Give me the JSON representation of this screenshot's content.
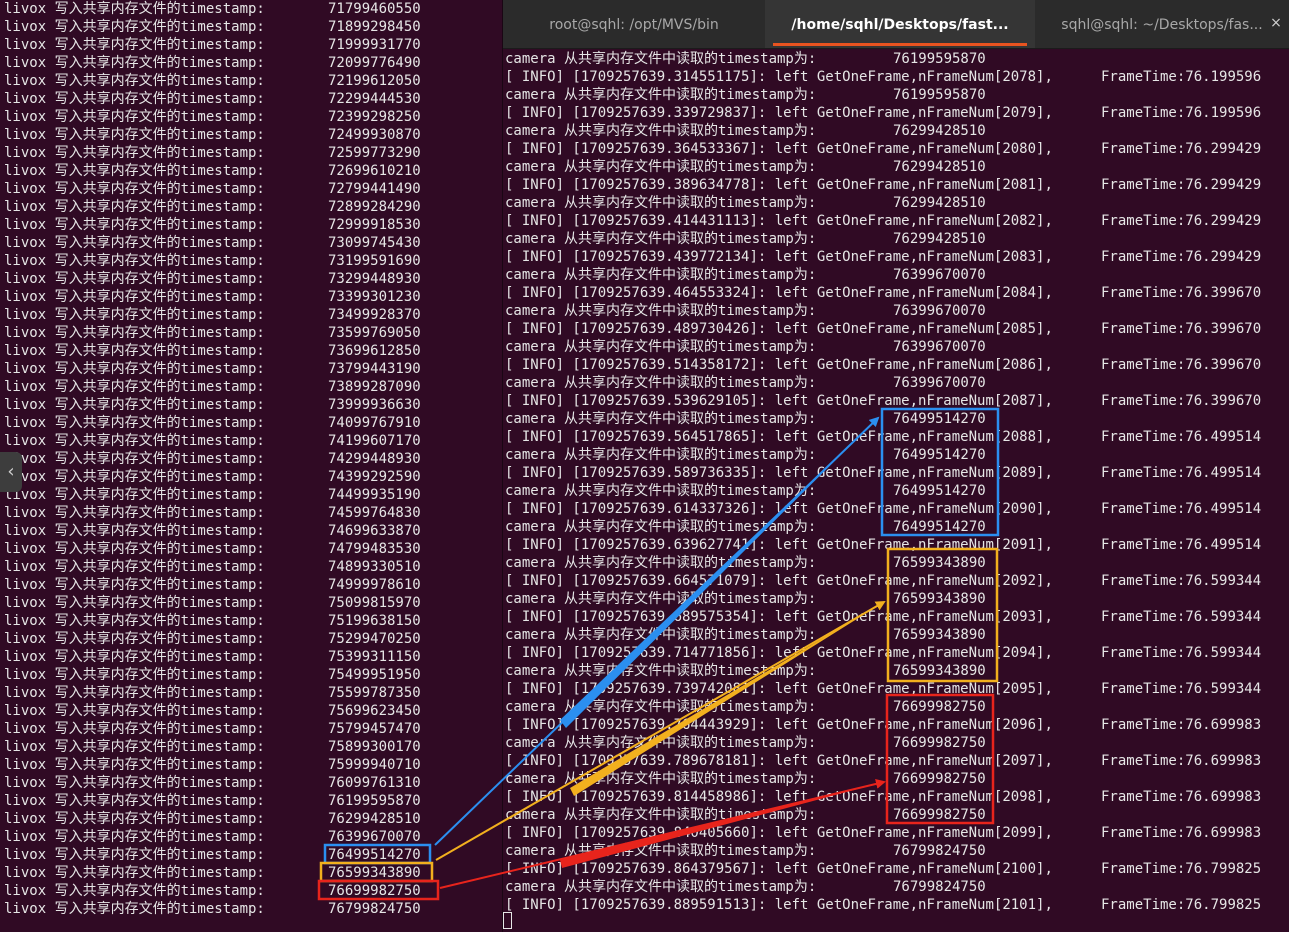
{
  "left_terminal": {
    "prefix": "livox 写入共享内存文件的timestamp:",
    "timestamps": [
      "71799460550",
      "71899298450",
      "71999931770",
      "72099776490",
      "72199612050",
      "72299444530",
      "72399298250",
      "72499930870",
      "72599773290",
      "72699610210",
      "72799441490",
      "72899284290",
      "72999918530",
      "73099745430",
      "73199591690",
      "73299448930",
      "73399301230",
      "73499928370",
      "73599769050",
      "73699612850",
      "73799443190",
      "73899287090",
      "73999936630",
      "74099767910",
      "74199607170",
      "74299448930",
      "74399292590",
      "74499935190",
      "74599764830",
      "74699633870",
      "74799483530",
      "74899330510",
      "74999978610",
      "75099815970",
      "75199638150",
      "75299470250",
      "75399311150",
      "75499951950",
      "75599787350",
      "75699623450",
      "75799457470",
      "75899300170",
      "75999940710",
      "76099761310",
      "76199595870",
      "76299428510",
      "76399670070",
      "76499514270",
      "76599343890",
      "76699982750",
      "76799824750"
    ],
    "handle_glyph": "‹"
  },
  "tabs": [
    {
      "label": "root@sqhl: /opt/MVS/bin",
      "active": false
    },
    {
      "label": "/home/sqhl/Desktops/fast...",
      "active": true
    },
    {
      "label": "sqhl@sqhl: ~/Desktops/fas...",
      "active": false
    }
  ],
  "tab_close_glyph": "×",
  "right_terminal": {
    "camera_prefix": "camera 从共享内存文件中读取的timestamp为:",
    "info_lines": [
      {
        "time": "1709257639.314551175",
        "frame": "2078",
        "ft": "76.199596"
      },
      {
        "time": "1709257639.339729837",
        "frame": "2079",
        "ft": "76.199596"
      },
      {
        "time": "1709257639.364533367",
        "frame": "2080",
        "ft": "76.299429"
      },
      {
        "time": "1709257639.389634778",
        "frame": "2081",
        "ft": "76.299429"
      },
      {
        "time": "1709257639.414431113",
        "frame": "2082",
        "ft": "76.299429"
      },
      {
        "time": "1709257639.439772134",
        "frame": "2083",
        "ft": "76.299429"
      },
      {
        "time": "1709257639.464553324",
        "frame": "2084",
        "ft": "76.399670"
      },
      {
        "time": "1709257639.489730426",
        "frame": "2085",
        "ft": "76.399670"
      },
      {
        "time": "1709257639.514358172",
        "frame": "2086",
        "ft": "76.399670"
      },
      {
        "time": "1709257639.539629105",
        "frame": "2087",
        "ft": "76.399670"
      },
      {
        "time": "1709257639.564517865",
        "frame": "2088",
        "ft": "76.499514"
      },
      {
        "time": "1709257639.589736335",
        "frame": "2089",
        "ft": "76.499514"
      },
      {
        "time": "1709257639.614337326",
        "frame": "2090",
        "ft": "76.499514"
      },
      {
        "time": "1709257639.639627741",
        "frame": "2091",
        "ft": "76.499514"
      },
      {
        "time": "1709257639.664571079",
        "frame": "2092",
        "ft": "76.599344"
      },
      {
        "time": "1709257639.689575354",
        "frame": "2093",
        "ft": "76.599344"
      },
      {
        "time": "1709257639.714771856",
        "frame": "2094",
        "ft": "76.599344"
      },
      {
        "time": "1709257639.739742081",
        "frame": "2095",
        "ft": "76.599344"
      },
      {
        "time": "1709257639.764443929",
        "frame": "2096",
        "ft": "76.699983"
      },
      {
        "time": "1709257639.789678181",
        "frame": "2097",
        "ft": "76.699983"
      },
      {
        "time": "1709257639.814458986",
        "frame": "2098",
        "ft": "76.699983"
      },
      {
        "time": "1709257639.840405660",
        "frame": "2099",
        "ft": "76.699983"
      },
      {
        "time": "1709257639.864379567",
        "frame": "2100",
        "ft": "76.799825"
      },
      {
        "time": "1709257639.889591513",
        "frame": "2101",
        "ft": "76.799825"
      }
    ],
    "camera_values": [
      "76199595870",
      "76199595870",
      "76299428510",
      "76299428510",
      "76299428510",
      "76299428510",
      "76399670070",
      "76399670070",
      "76399670070",
      "76399670070",
      "76499514270",
      "76499514270",
      "76499514270",
      "76499514270",
      "76599343890",
      "76599343890",
      "76599343890",
      "76599343890",
      "76699982750",
      "76699982750",
      "76699982750",
      "76699982750",
      "76799824750",
      "76799824750"
    ],
    "info_template": {
      "open": "[ INFO] [",
      "mid": "]: left GetOneFrame,nFrameNum[",
      "close": "],",
      "ft_label": "FrameTime:"
    }
  },
  "annotations": {
    "colors": {
      "blue": "#2b8ff0",
      "yellow": "#f2b01e",
      "red": "#e8241c"
    }
  }
}
